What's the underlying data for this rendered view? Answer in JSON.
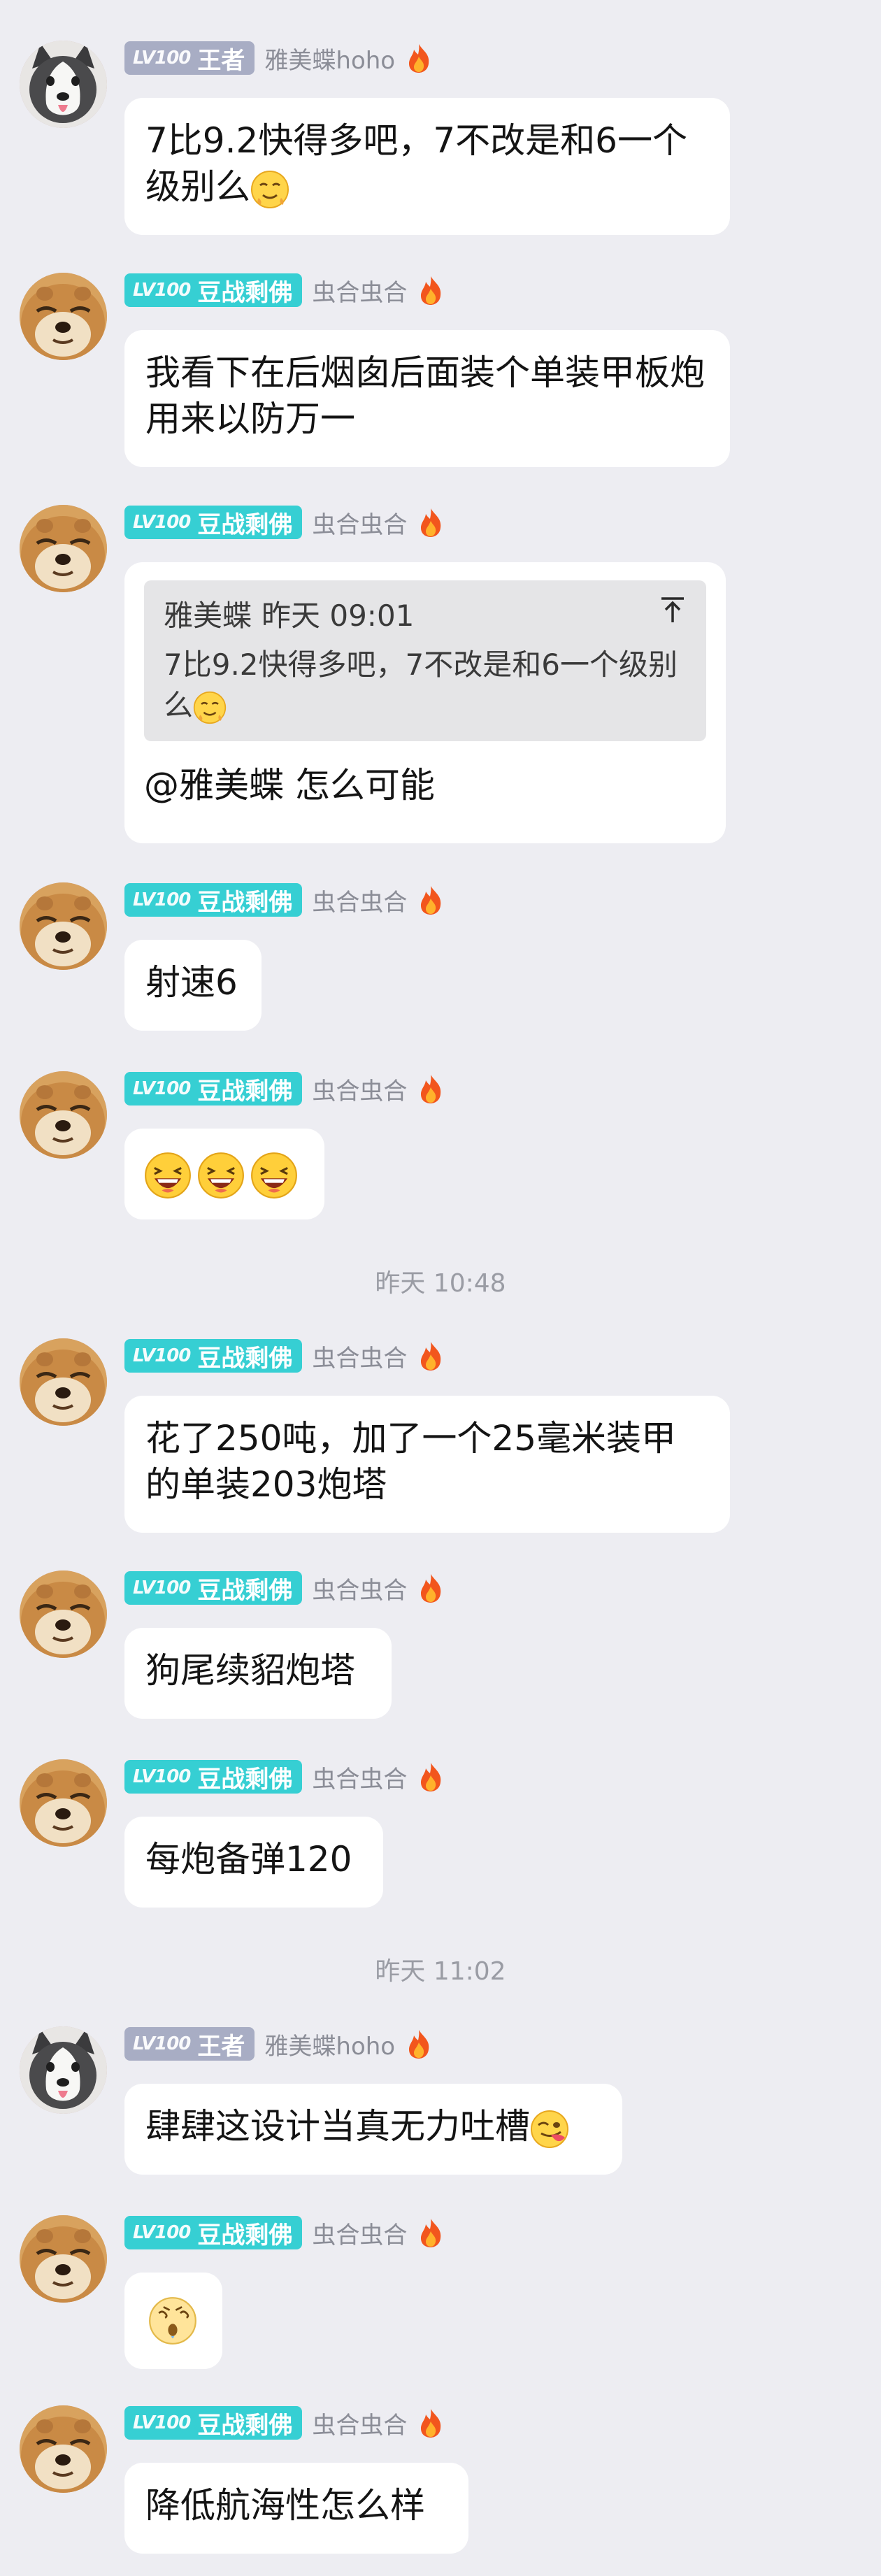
{
  "users": {
    "yameidie": {
      "level": "LV100",
      "title": "王者",
      "nickname": "雅美蝶hoho",
      "badge_color": "#a8adc4"
    },
    "douzhan": {
      "level": "LV100",
      "title": "豆战剩佛",
      "nickname": "虫合虫合",
      "badge_color": "#36cfd3"
    }
  },
  "messages": [
    {
      "user": "yameidie",
      "text": "7比9.2快得多吧，7不改是和6一个级别么",
      "emoji": "sweat-smile"
    },
    {
      "user": "douzhan",
      "text": "我看下在后烟囱后面装个单装甲板炮用来以防万一"
    },
    {
      "user": "douzhan",
      "quote": {
        "author": "雅美蝶",
        "time": "昨天 09:01",
        "text": "7比9.2快得多吧，7不改是和6一个级别么"
      },
      "text": "@雅美蝶 怎么可能"
    },
    {
      "user": "douzhan",
      "text": "射速6"
    },
    {
      "user": "douzhan",
      "text": "",
      "emojis": [
        "laugh",
        "laugh",
        "laugh"
      ]
    },
    {
      "user": "douzhan",
      "text": "花了250吨，加了一个25毫米装甲的单装203炮塔"
    },
    {
      "user": "douzhan",
      "text": "狗尾续貂炮塔"
    },
    {
      "user": "douzhan",
      "text": "每炮备弹120"
    },
    {
      "user": "yameidie",
      "text": "肆肆这设计当真无力吐槽",
      "emoji": "tongue"
    },
    {
      "user": "douzhan",
      "text": "",
      "emojis": [
        "dizzy"
      ]
    },
    {
      "user": "douzhan",
      "text": "降低航海性怎么样"
    }
  ],
  "timestamps": [
    "昨天 10:48",
    "昨天 11:02"
  ]
}
